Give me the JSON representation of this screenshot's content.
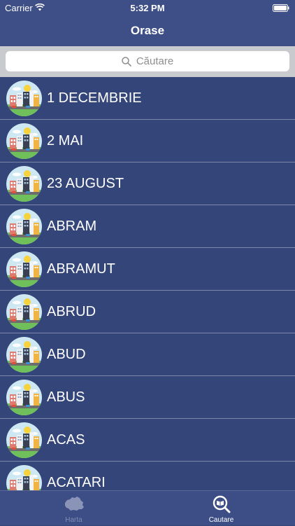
{
  "status_bar": {
    "carrier": "Carrier",
    "time": "5:32 PM"
  },
  "nav": {
    "title": "Orase"
  },
  "search": {
    "placeholder": "Căutare"
  },
  "cities": [
    "1 DECEMBRIE",
    "2 MAI",
    "23 AUGUST",
    "ABRAM",
    "ABRAMUT",
    "ABRUD",
    "ABUD",
    "ABUS",
    "ACAS",
    "ACATARI"
  ],
  "tabs": [
    {
      "label": "Harta",
      "icon": "romania-map-icon",
      "selected": false
    },
    {
      "label": "Cautare",
      "icon": "search-book-icon",
      "selected": true
    }
  ],
  "colors": {
    "background": "#34457a",
    "bar": "#3d4f86",
    "separator": "#7c87ab",
    "search_area": "#c9cace",
    "tab_inactive": "#7f8bb3"
  }
}
